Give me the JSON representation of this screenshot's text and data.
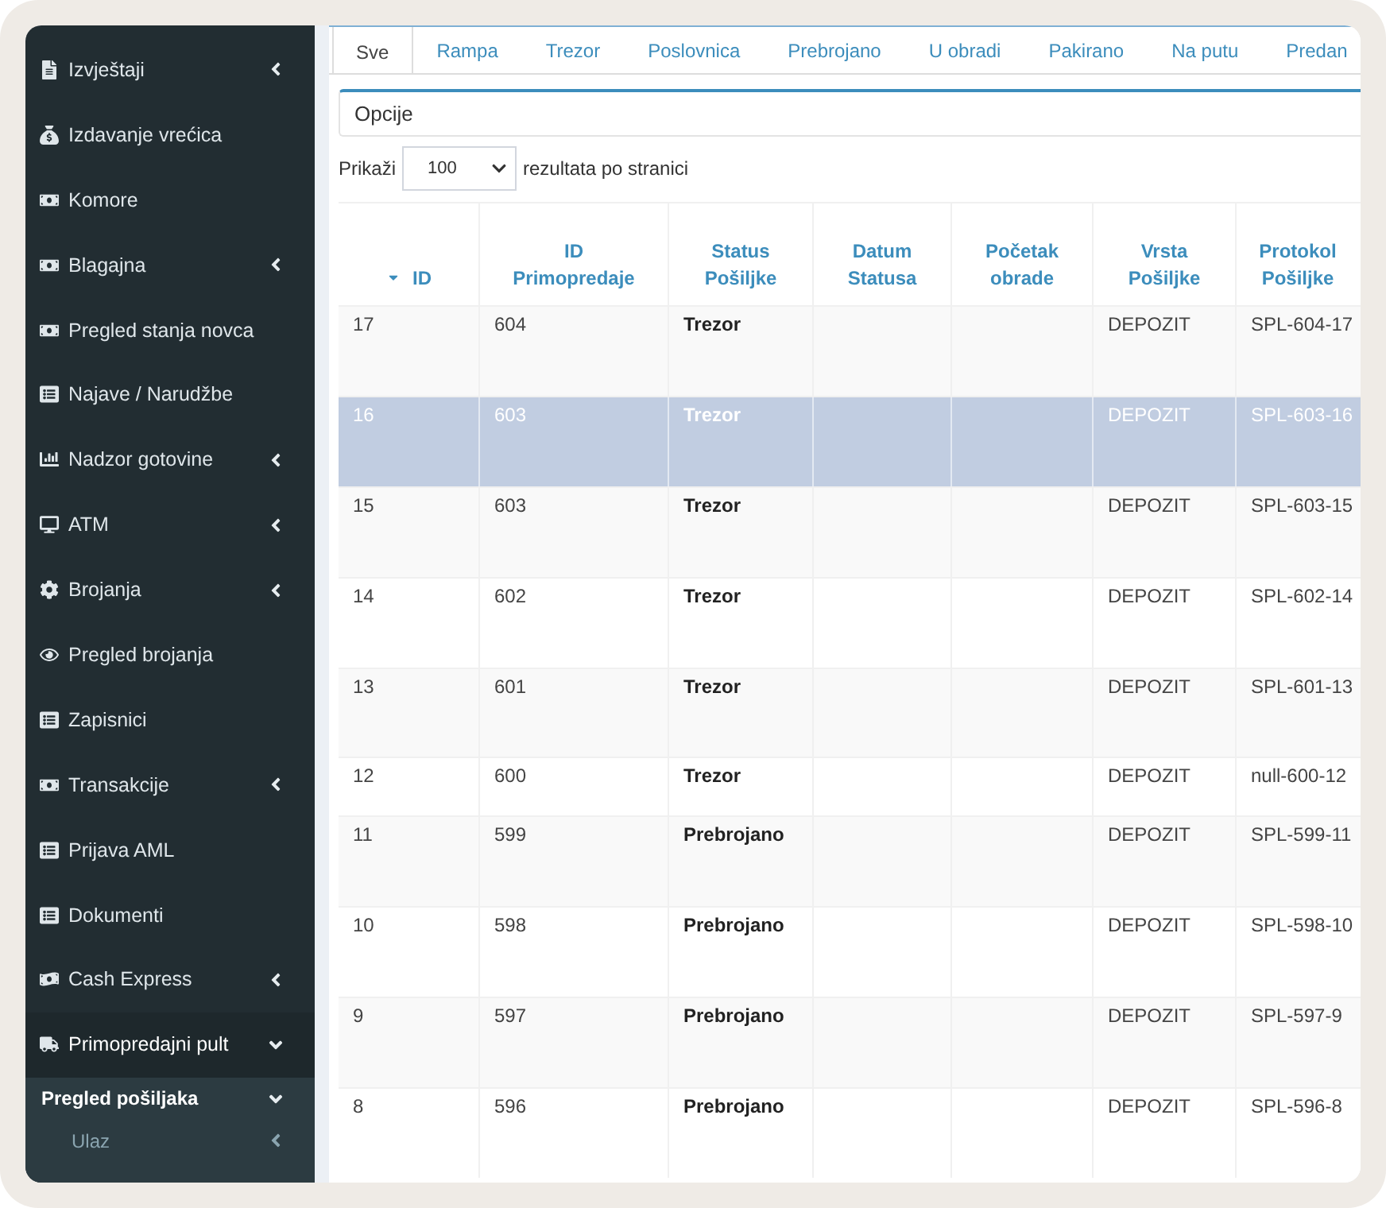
{
  "sidebar": {
    "items": [
      {
        "label": "Izvještaji",
        "expanded": false
      },
      {
        "label": "Izdavanje vrećica"
      },
      {
        "label": "Komore"
      },
      {
        "label": "Blagajna",
        "expanded": false
      },
      {
        "label": "Pregled stanja novca"
      },
      {
        "label": "Najave / Narudžbe"
      },
      {
        "label": "Nadzor gotovine",
        "expanded": false
      },
      {
        "label": "ATM",
        "expanded": false
      },
      {
        "label": "Brojanja",
        "expanded": false
      },
      {
        "label": "Pregled brojanja"
      },
      {
        "label": "Zapisnici"
      },
      {
        "label": "Transakcije",
        "expanded": false
      },
      {
        "label": "Prijava AML"
      },
      {
        "label": "Dokumenti"
      },
      {
        "label": "Cash Express",
        "expanded": false
      },
      {
        "label": "Primopredajni pult",
        "expanded": true,
        "children": [
          {
            "label": "Pregled pošiljaka",
            "expanded": true,
            "children": [
              {
                "label": "Ulaz",
                "expanded": false
              }
            ]
          }
        ]
      }
    ]
  },
  "tabs": [
    {
      "label": "Sve",
      "selected": true
    },
    {
      "label": "Rampa",
      "selected": false
    },
    {
      "label": "Trezor",
      "selected": false
    },
    {
      "label": "Poslovnica",
      "selected": false
    },
    {
      "label": "Prebrojano",
      "selected": false
    },
    {
      "label": "U obradi",
      "selected": false
    },
    {
      "label": "Pakirano",
      "selected": false
    },
    {
      "label": "Na putu",
      "selected": false
    },
    {
      "label": "Predan",
      "selected": false
    }
  ],
  "options_panel": {
    "title": "Opcije"
  },
  "page_length": {
    "label": "Prikaži",
    "value": "100",
    "suffix": "rezultata po stranici"
  },
  "table": {
    "columns": [
      {
        "label": "ID",
        "sorted": true
      },
      {
        "label": "ID Primopredaje",
        "sorted": false
      },
      {
        "label": "Status Pošiljke",
        "sorted": false
      },
      {
        "label": "Datum Statusa",
        "sorted": false
      },
      {
        "label": "Početak obrade",
        "sorted": false
      },
      {
        "label": "Vrsta Pošiljke",
        "sorted": false
      },
      {
        "label": "Protokol Pošiljke",
        "sorted": false
      }
    ],
    "rows": [
      {
        "id": "17",
        "handover_id": "604",
        "status": "Trezor",
        "shipment_type": "DEPOZIT",
        "protocol": "SPL-604-17",
        "selected": false,
        "compact": false
      },
      {
        "id": "16",
        "handover_id": "603",
        "status": "Trezor",
        "shipment_type": "DEPOZIT",
        "protocol": "SPL-603-16",
        "selected": true,
        "compact": false
      },
      {
        "id": "15",
        "handover_id": "603",
        "status": "Trezor",
        "shipment_type": "DEPOZIT",
        "protocol": "SPL-603-15",
        "selected": false,
        "compact": false
      },
      {
        "id": "14",
        "handover_id": "602",
        "status": "Trezor",
        "shipment_type": "DEPOZIT",
        "protocol": "SPL-602-14",
        "selected": false,
        "compact": false
      },
      {
        "id": "13",
        "handover_id": "601",
        "status": "Trezor",
        "shipment_type": "DEPOZIT",
        "protocol": "SPL-601-13",
        "selected": false,
        "compact": false
      },
      {
        "id": "12",
        "handover_id": "600",
        "status": "Trezor",
        "shipment_type": "DEPOZIT",
        "protocol": "null-600-12",
        "selected": false,
        "compact": true
      },
      {
        "id": "11",
        "handover_id": "599",
        "status": "Prebrojano",
        "shipment_type": "DEPOZIT",
        "protocol": "SPL-599-11",
        "selected": false,
        "compact": false
      },
      {
        "id": "10",
        "handover_id": "598",
        "status": "Prebrojano",
        "shipment_type": "DEPOZIT",
        "protocol": "SPL-598-10",
        "selected": false,
        "compact": false
      },
      {
        "id": "9",
        "handover_id": "597",
        "status": "Prebrojano",
        "shipment_type": "DEPOZIT",
        "protocol": "SPL-597-9",
        "selected": false,
        "compact": false
      },
      {
        "id": "8",
        "handover_id": "596",
        "status": "Prebrojano",
        "shipment_type": "DEPOZIT",
        "protocol": "SPL-596-8",
        "selected": false,
        "compact": false
      }
    ]
  }
}
